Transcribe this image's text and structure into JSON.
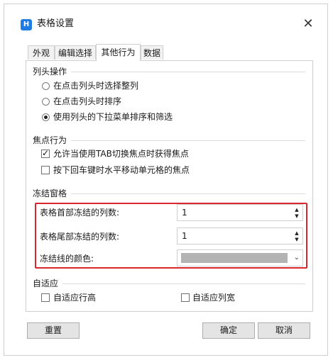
{
  "window": {
    "title": "表格设置",
    "icon": "app-logo-icon",
    "close_glyph": "✕"
  },
  "tabs": [
    {
      "label": "外观",
      "active": false
    },
    {
      "label": "编辑选择",
      "active": false
    },
    {
      "label": "其他行为",
      "active": true
    },
    {
      "label": "数据",
      "active": false
    }
  ],
  "column_header": {
    "title": "列头操作",
    "options": [
      {
        "label": "在点击列头时选择整列",
        "selected": false
      },
      {
        "label": "在点击列头时排序",
        "selected": false
      },
      {
        "label": "使用列头的下拉菜单排序和筛选",
        "selected": true
      }
    ]
  },
  "focus": {
    "title": "焦点行为",
    "options": [
      {
        "label": "允许当使用TAB切换焦点时获得焦点",
        "checked": true
      },
      {
        "label": "按下回车键时水平移动单元格的焦点",
        "checked": false
      }
    ]
  },
  "freeze": {
    "title": "冻结窗格",
    "head_label": "表格首部冻结的列数:",
    "head_value": "1",
    "tail_label": "表格尾部冻结的列数:",
    "tail_value": "1",
    "line_color_label": "冻结线的颜色:",
    "line_color": "#b3b3b3",
    "highlight_color": "#d9262d"
  },
  "autofit": {
    "title": "自适应",
    "row_height_label": "自适应行高",
    "row_height_checked": false,
    "col_width_label": "自适应列宽",
    "col_width_checked": false
  },
  "buttons": {
    "reset": "重置",
    "ok": "确定",
    "cancel": "取消"
  },
  "colors": {
    "accent": "#1e7ce3",
    "border": "#cfcfcf"
  }
}
